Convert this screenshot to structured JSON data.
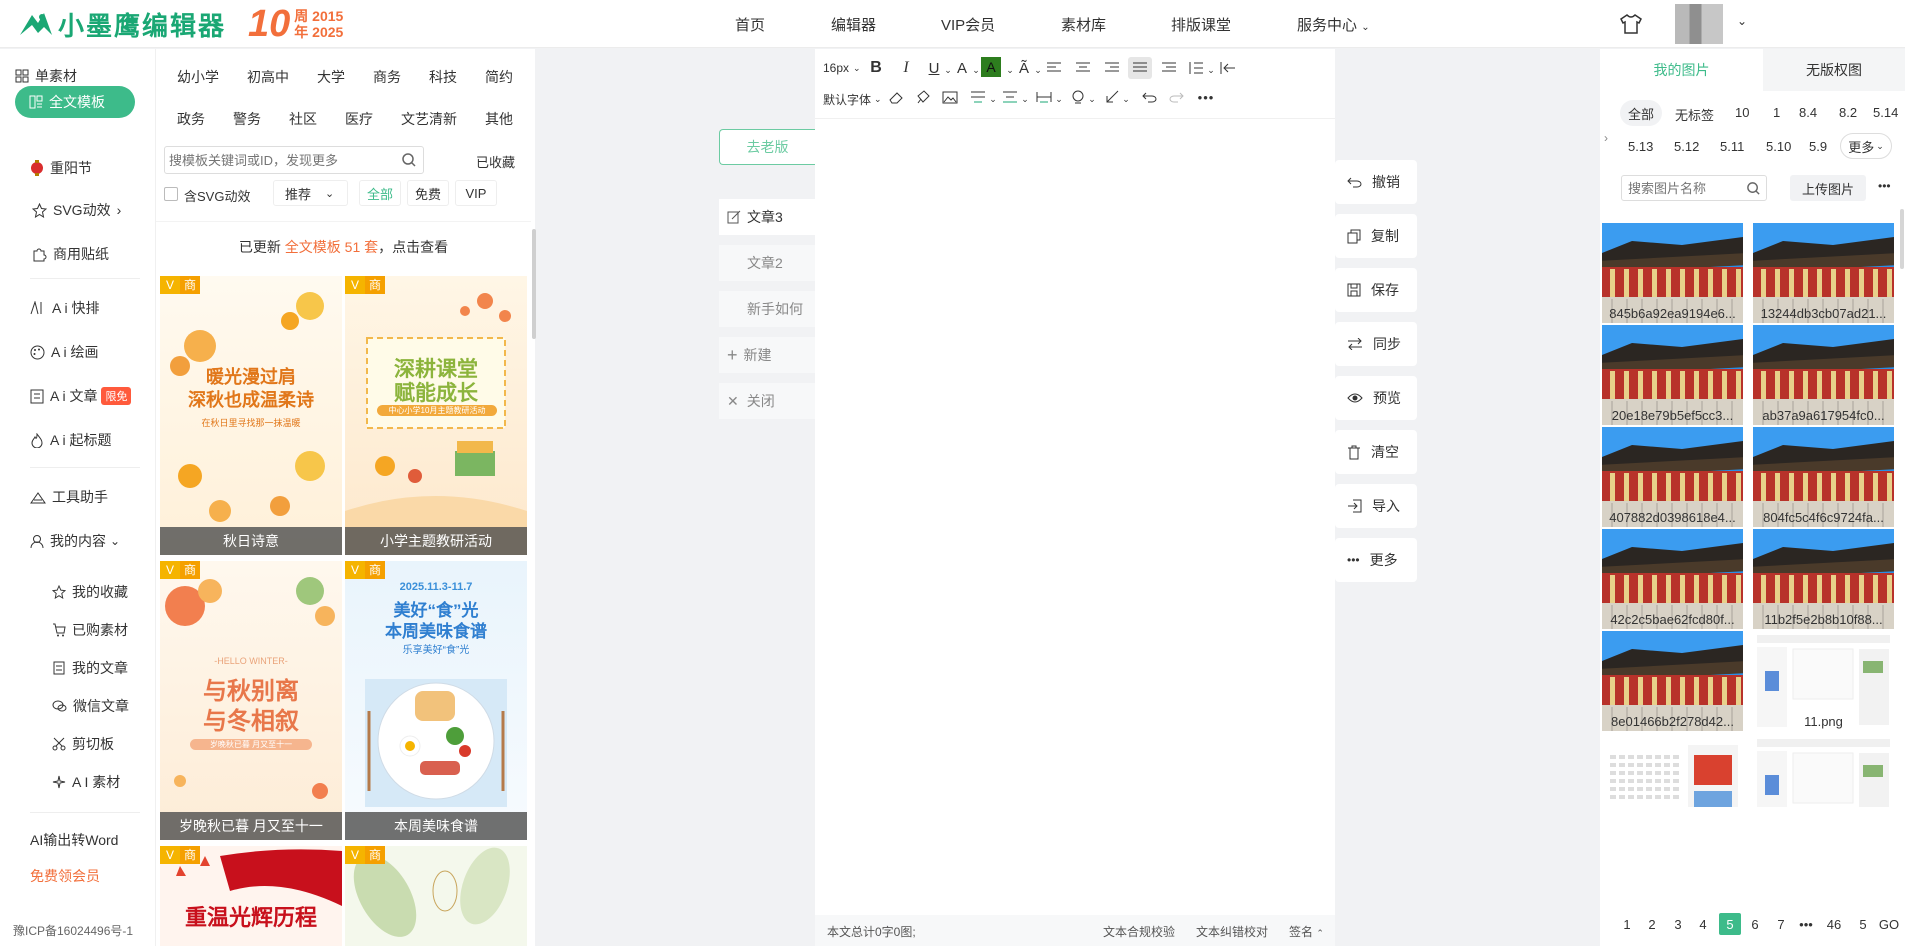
{
  "logo": {
    "brand": "小墨鹰编辑器",
    "ten": "10",
    "year1": "周 2015",
    "year2": "年 2025"
  },
  "nav": [
    "首页",
    "编辑器",
    "VIP会员",
    "素材库",
    "排版课堂",
    "服务中心"
  ],
  "left_nav": {
    "items": [
      "单素材",
      "全文模板",
      "重阳节",
      "SVG动效",
      "商用贴纸",
      "A i 快排",
      "A i 绘画",
      "A i 文章",
      "A i 起标题",
      "工具助手",
      "我的内容"
    ],
    "ai_article_badge": "限免",
    "my_content_sub": [
      "我的收藏",
      "已购素材",
      "我的文章",
      "微信文章",
      "剪切板",
      "A I 素材"
    ],
    "ai_word": "AI输出转Word",
    "free_vip": "免费领会员",
    "icp": "豫ICP备16024496号-1"
  },
  "templates": {
    "categories_row1": [
      "幼小学",
      "初高中",
      "大学",
      "商务",
      "科技",
      "简约"
    ],
    "categories_row2": [
      "政务",
      "警务",
      "社区",
      "医疗",
      "文艺清新",
      "其他"
    ],
    "search_placeholder": "搜模板关键词或ID，发现更多",
    "collected": "已收藏",
    "svg_check": "含SVG动效",
    "sort": "推荐",
    "filters": [
      "全部",
      "免费",
      "VIP"
    ],
    "update_prefix": "已更新",
    "update_highlight": "全文模板 51 套",
    "update_suffix": "，点击查看",
    "badge_text": "商",
    "cards": [
      {
        "title": "秋日诗意",
        "line1": "暖光漫过肩",
        "line2": "深秋也成温柔诗",
        "sub": "在秋日里寻找那一抹温暖"
      },
      {
        "title": "小学主题教研活动",
        "line1": "深耕课堂",
        "line2": "赋能成长",
        "sub": "中心小学10月主题教研活动"
      },
      {
        "title": "岁晚秋已暮 月又至十一",
        "line0": "-HELLO WINTER-",
        "line1": "与秋别离",
        "line2": "与冬相叙",
        "sub": "岁晚秋已暮 月又至十一"
      },
      {
        "title": "本周美味食谱",
        "line0": "2025.11.3-11.7",
        "line1": "美好“食”光",
        "line2": "本周美味食谱",
        "sub": "乐享美好“食”光"
      },
      {
        "title": "",
        "line1": "重温光辉历程"
      },
      {
        "title": "",
        "line1": ""
      }
    ]
  },
  "doc_tabs": {
    "old_version": "去老版",
    "tabs": [
      "文章3",
      "文章2",
      "新手如何"
    ],
    "new": "新建",
    "close": "关闭"
  },
  "toolbar": {
    "font_size": "16px",
    "font_family": "默认字体"
  },
  "editor_footer": {
    "count": "本文总计0字0图;",
    "compliance": "文本合规校验",
    "correction": "文本纠错校对",
    "sign": "签名"
  },
  "ops": [
    "撤销",
    "复制",
    "保存",
    "同步",
    "预览",
    "清空",
    "导入",
    "更多"
  ],
  "images": {
    "tabs": [
      "我的图片",
      "无版权图"
    ],
    "tags_row1": [
      "全部",
      "无标签",
      "10",
      "1",
      "8.4",
      "8.2",
      "5.14"
    ],
    "tags_row2": [
      "5.13",
      "5.12",
      "5.11",
      "5.10",
      "5.9",
      "更多"
    ],
    "search_placeholder": "搜索图片名称",
    "upload": "上传图片",
    "labels": [
      "845b6a92ea9194e6...",
      "13244db3cb07ad21...",
      "20e18e79b5ef5cc3...",
      "ab37a9a617954fc0...",
      "407882d0398618e4...",
      "804fc5c4f6c9724fa...",
      "42c2c5bae62fcd80f...",
      "11b2f5e2b8b10f88...",
      "8e01466b2f278d42...",
      "11.png"
    ],
    "pages": [
      "1",
      "2",
      "3",
      "4",
      "5",
      "6",
      "7",
      "•••",
      "46",
      "5",
      "GO"
    ]
  },
  "colors": {
    "brand": "#1aa774",
    "orange": "#f26f3b",
    "accent_green": "#3dbb8a"
  }
}
